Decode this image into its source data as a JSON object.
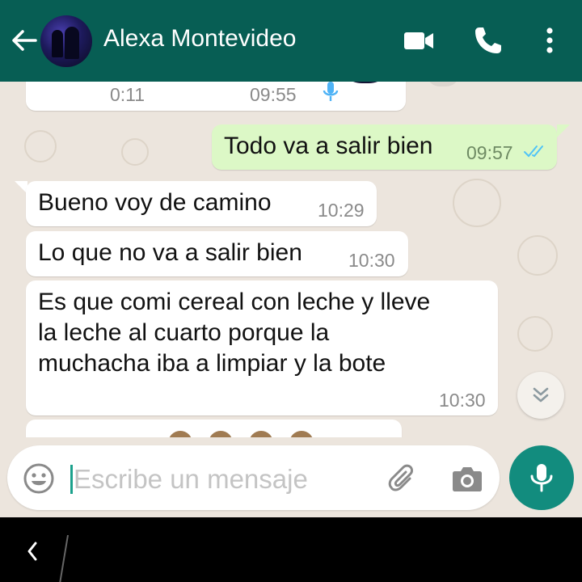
{
  "header": {
    "contact_name": "Alexa Montevideo"
  },
  "messages": {
    "voice_note": {
      "duration": "0:11",
      "time": "09:55"
    },
    "sent_1": {
      "text": "Todo va a salir bien",
      "time": "09:57",
      "status": "read"
    },
    "recv_1": {
      "text": "Bueno voy de camino",
      "time": "10:29"
    },
    "recv_2": {
      "text": "Lo que no va a salir bien",
      "time": "10:30"
    },
    "recv_3": {
      "lines": [
        "Es que comi cereal con leche y lleve",
        "la leche al cuarto porque la",
        "muchacha iba a limpiar y la bote"
      ],
      "time": "10:30"
    }
  },
  "input": {
    "placeholder": "Escribe un mensaje"
  },
  "colors": {
    "header": "#075e54",
    "accent": "#128c7e",
    "outgoing_bubble": "#dcf8c6",
    "incoming_bubble": "#ffffff",
    "chat_background": "#ece5dd",
    "read_ticks": "#4fc3f7"
  },
  "icons": {
    "back": "arrow-left-icon",
    "video": "video-camera-icon",
    "call": "phone-icon",
    "menu": "more-vert-icon",
    "mic": "mic-icon",
    "emoji": "emoji-icon",
    "attach": "paperclip-icon",
    "camera": "camera-icon",
    "scroll": "chevron-double-down-icon",
    "nav_back": "nav-back-icon"
  }
}
